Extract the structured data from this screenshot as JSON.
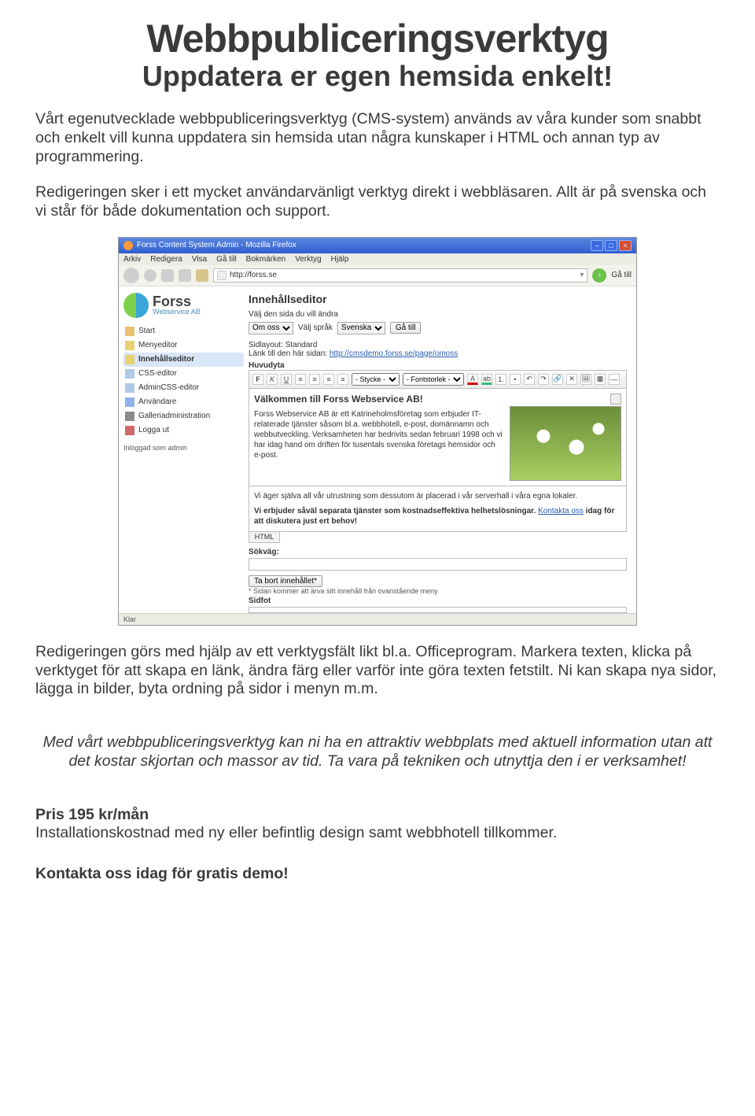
{
  "title": "Webbpubliceringsverktyg",
  "subtitle": "Uppdatera er egen hemsida enkelt!",
  "para1": "Vårt egenutvecklade webbpubliceringsverktyg (CMS-system) används av våra kunder som snabbt och enkelt vill kunna uppdatera sin hemsida utan några kunskaper i HTML och annan typ av programmering.",
  "para2": "Redigeringen sker i ett mycket användarvänligt verktyg direkt i webbläsaren. Allt är på svenska och vi står för både dokumentation och support.",
  "para3": "Redigeringen görs med hjälp av ett verktygsfält likt bl.a. Officeprogram. Markera texten, klicka på verktyget för att skapa en länk, ändra färg eller varför inte göra texten fetstilt. Ni kan skapa nya sidor, lägga in bilder, byta ordning på sidor i menyn m.m.",
  "italic1": "Med vårt webbpubliceringsverktyg kan ni ha en attraktiv webbplats med aktuell information utan att det kostar skjortan och massor av tid. Ta vara på tekniken och utnyttja den i er verksamhet!",
  "price": "Pris 195 kr/mån",
  "install": "Installationskostnad med ny eller befintlig design samt webbhotell tillkommer.",
  "contact": "Kontakta oss idag för gratis demo!",
  "shot": {
    "window_title": "Forss Content System Admin - Mozilla Firefox",
    "menus": [
      "Arkiv",
      "Redigera",
      "Visa",
      "Gå till",
      "Bokmärken",
      "Verktyg",
      "Hjälp"
    ],
    "url": "http://forss.se",
    "go_label": "Gå till",
    "logo_name": "Forss",
    "logo_sub": "Webservice AB",
    "sidebar": {
      "items": [
        {
          "label": "Start"
        },
        {
          "label": "Menyeditor"
        },
        {
          "label": "Innehållseditor"
        },
        {
          "label": "CSS-editor"
        },
        {
          "label": "AdminCSS-editor"
        },
        {
          "label": "Användare"
        },
        {
          "label": "Galleriadministration"
        },
        {
          "label": "Logga ut"
        }
      ],
      "loggedin": "Inloggad som admin"
    },
    "main": {
      "heading": "Innehållseditor",
      "choose_label": "Välj den sida du vill ändra",
      "page_select": "Om oss",
      "lang_label": "Välj språk",
      "lang_select": "Svenska",
      "go_btn": "Gå till",
      "layout_label": "Sidlayout: Standard",
      "link_label": "Länk till den här sidan: ",
      "link_url": "http://cmsdemo.forss.se/page/omoss",
      "huvudyta": "Huvudyta",
      "style_sel": "- Stycke -",
      "font_sel": "- Fontstorlek -",
      "welcome": "Välkommen till Forss Webservice AB!",
      "body1": "Forss Webservice AB är ett Katrineholmsföretag som erbjuder IT-relaterade tjänster såsom bl.a. webbhotell, e-post, domännamn och webbutveckling. Verksamheten har bedrivits sedan februari 1998 och vi har idag hand om driften för tusentals svenska företags hemsidor och e-post.",
      "body2": "Vi äger själva all vår utrustning som dessutom är placerad i vår serverhall i våra egna lokaler.",
      "body3a": "Vi erbjuder såväl separata tjänster som kostnadseffektiva helhetslösningar. ",
      "body3_link": "Kontakta oss",
      "body3b": " idag för att diskutera just ert behov!",
      "html_tab": "HTML",
      "sokvag": "Sökväg:",
      "tabort": "Ta bort innehållet*",
      "footnote": "* Sidan kommer att ärva sitt innehåll från ovanstående meny",
      "sidfot": "Sidfot"
    },
    "status": "Klar"
  }
}
